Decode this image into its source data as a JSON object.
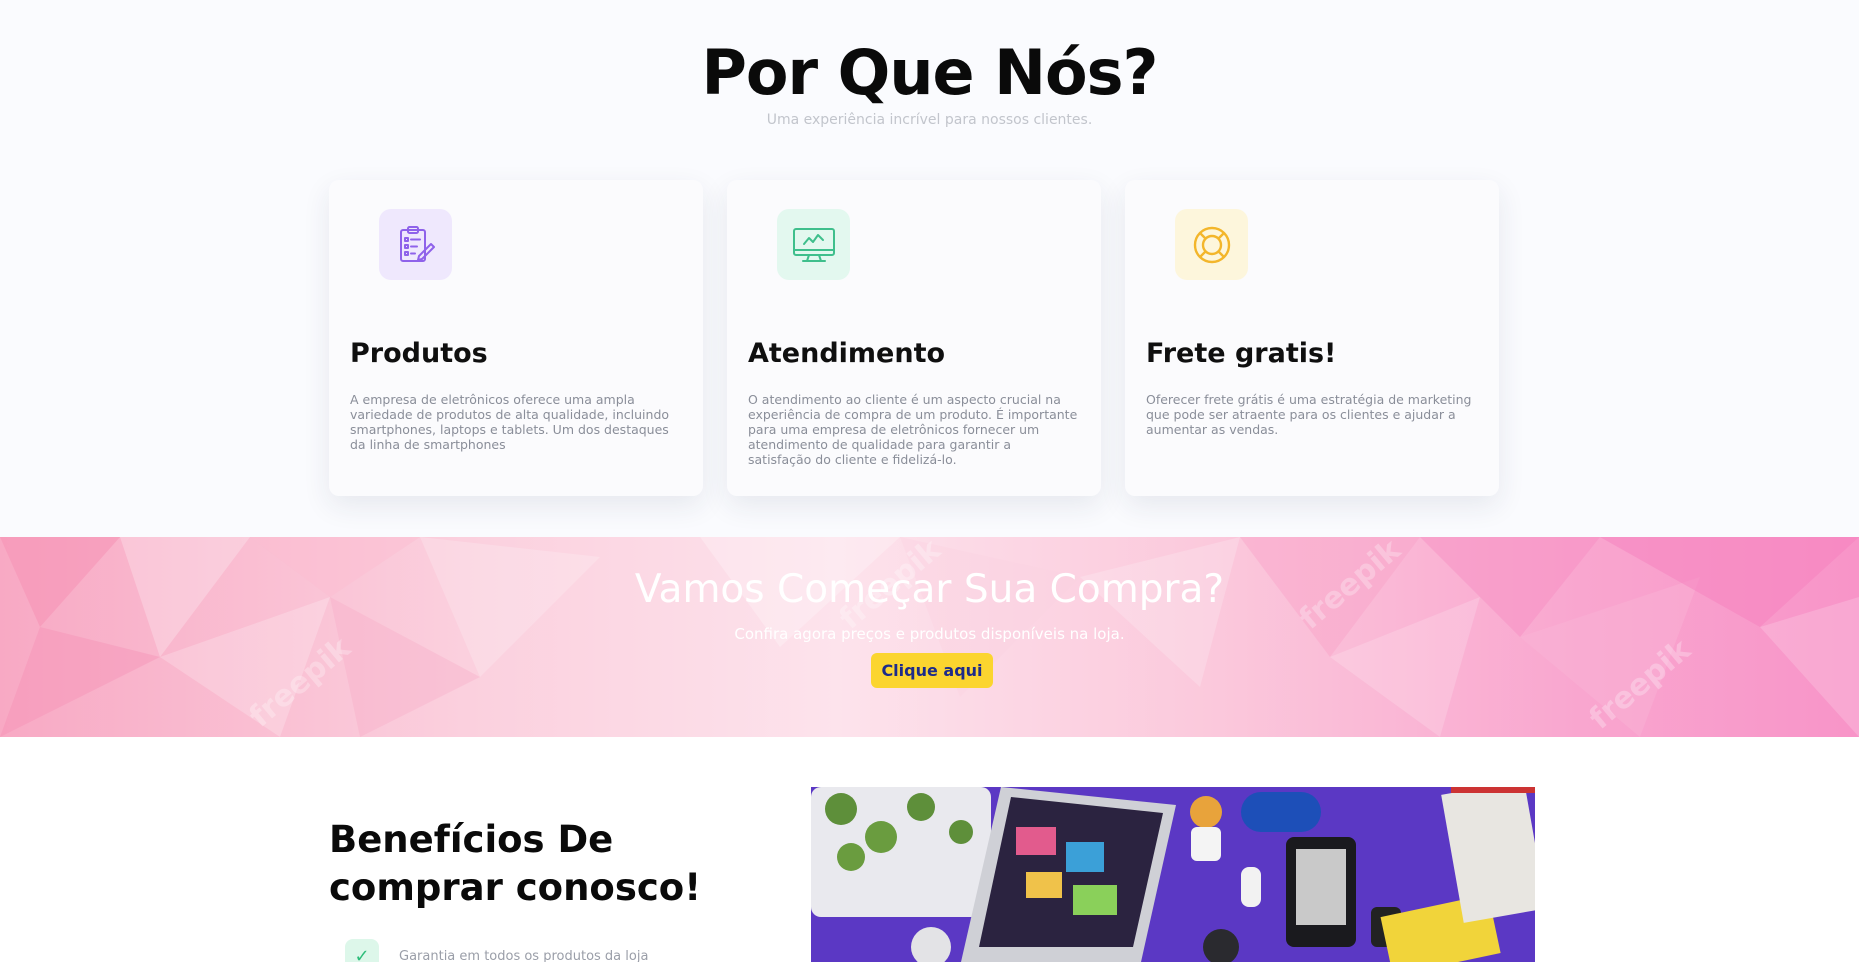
{
  "why": {
    "title": "Por Que Nós?",
    "subtitle": "Uma experiência incrível para nossos clientes.",
    "cards": [
      {
        "icon": "clipboard-checklist-icon",
        "icon_color": "#8f62ea",
        "icon_bg": "#efe8fd",
        "title": "Produtos",
        "text": "A empresa de eletrônicos oferece uma ampla variedade de produtos de alta qualidade, incluindo smartphones, laptops e tablets. Um dos destaques da linha de smartphones"
      },
      {
        "icon": "monitor-chart-icon",
        "icon_color": "#3fbf8c",
        "icon_bg": "#e3f8ef",
        "title": "Atendimento",
        "text": "O atendimento ao cliente é um aspecto crucial na experiência de compra de um produto. É importante para uma empresa de eletrônicos fornecer um atendimento de qualidade para garantir a satisfação do cliente e fidelizá-lo."
      },
      {
        "icon": "lifebuoy-icon",
        "icon_color": "#f3b62b",
        "icon_bg": "#fdf6dc",
        "title": "Frete gratis!",
        "text": "Oferecer frete grátis é uma estratégia de marketing que pode ser atraente para os clientes e ajudar a aumentar as vendas."
      }
    ]
  },
  "cta": {
    "title": "Vamos Começar Sua Compra?",
    "subtitle": "Confira agora preços e produtos disponíveis na loja.",
    "button_label": "Clique aqui",
    "button_color": "#fbd52f",
    "watermark": "freepik"
  },
  "benefits": {
    "title": "Benefícios De comprar conosco!",
    "items": [
      {
        "icon": "check-icon",
        "text": "Garantia em todos os produtos da loja"
      }
    ]
  }
}
